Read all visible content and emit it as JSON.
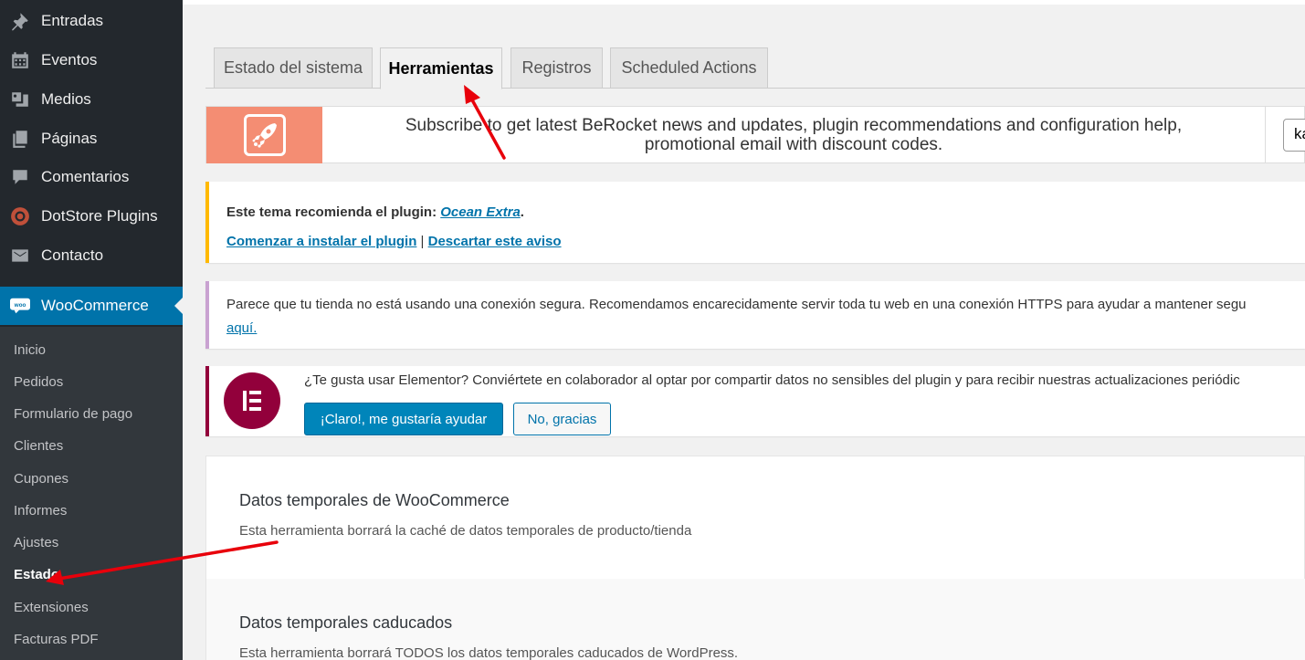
{
  "sidebar": {
    "items": [
      {
        "label": "Entradas",
        "icon": "pin-icon"
      },
      {
        "label": "Eventos",
        "icon": "calendar-icon"
      },
      {
        "label": "Medios",
        "icon": "media-icon"
      },
      {
        "label": "Páginas",
        "icon": "pages-icon"
      },
      {
        "label": "Comentarios",
        "icon": "comment-icon"
      },
      {
        "label": "DotStore Plugins",
        "icon": "dotstore-icon"
      },
      {
        "label": "Contacto",
        "icon": "mail-icon"
      },
      {
        "label": "WooCommerce",
        "icon": "woo-icon"
      }
    ],
    "woo_logo_text": "woo",
    "submenu": [
      "Inicio",
      "Pedidos",
      "Formulario de pago",
      "Clientes",
      "Cupones",
      "Informes",
      "Ajustes",
      "Estado",
      "Extensiones",
      "Facturas PDF"
    ],
    "current_submenu": "Estado"
  },
  "tabs": [
    {
      "label": "Estado del sistema",
      "active": false
    },
    {
      "label": "Herramientas",
      "active": true
    },
    {
      "label": "Registros",
      "active": false
    },
    {
      "label": "Scheduled Actions",
      "active": false
    }
  ],
  "berocket": {
    "line1": "Subscribe to get latest BeRocket news and updates, plugin recommendations and configuration help,",
    "line2": "promotional email with discount codes.",
    "email_value": "ka"
  },
  "notice_ocean": {
    "prefix": "Este tema recomienda el plugin: ",
    "plugin": "Ocean Extra",
    "suffix": ".",
    "install_link": "Comenzar a instalar el plugin",
    "separator": " | ",
    "dismiss_link": "Descartar este aviso"
  },
  "notice_https": {
    "text": "Parece que tu tienda no está usando una conexión segura. Recomendamos encarecidamente servir toda tu web en una conexión HTTPS para ayudar a mantener segu",
    "link": "aquí."
  },
  "notice_elementor": {
    "text": "¿Te gusta usar Elementor? Conviértete en colaborador al optar por compartir datos no sensibles del plugin y para recibir nuestras actualizaciones periódic",
    "accept_label": "¡Claro!, me gustaría ayudar",
    "decline_label": "No, gracias"
  },
  "tools": [
    {
      "title": "Datos temporales de WooCommerce",
      "desc": "Esta herramienta borrará la caché de datos temporales de producto/tienda"
    },
    {
      "title": "Datos temporales caducados",
      "desc": "Esta herramienta borrará TODOS los datos temporales caducados de WordPress."
    }
  ],
  "colors": {
    "sidebar_bg": "#23282d",
    "submenu_bg": "#32373c",
    "accent": "#0073aa",
    "berocket_orange": "#f48d73",
    "elementor": "#92003b",
    "annotation_arrow": "#e8000b"
  }
}
